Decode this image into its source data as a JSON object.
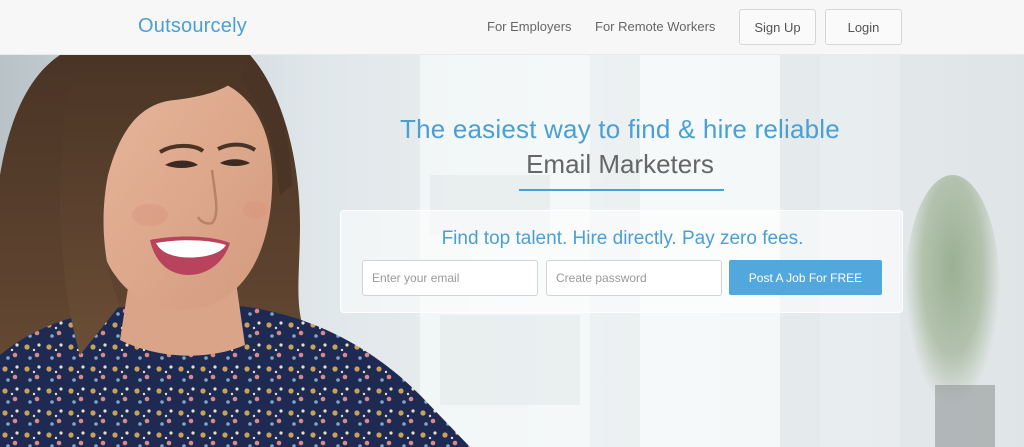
{
  "header": {
    "logo": "Outsourcely",
    "nav": {
      "employers": "For Employers",
      "remote_workers": "For Remote Workers"
    },
    "sign_up": "Sign Up",
    "login": "Login"
  },
  "hero": {
    "headline": "The easiest way to find & hire reliable",
    "role": "Email Marketers",
    "tagline": "Find top talent. Hire directly. Pay zero fees.",
    "email_placeholder": "Enter your email",
    "password_placeholder": "Create password",
    "cta": "Post A Job For FREE"
  },
  "colors": {
    "accent": "#4a9fd4",
    "button": "#52a7dc"
  }
}
